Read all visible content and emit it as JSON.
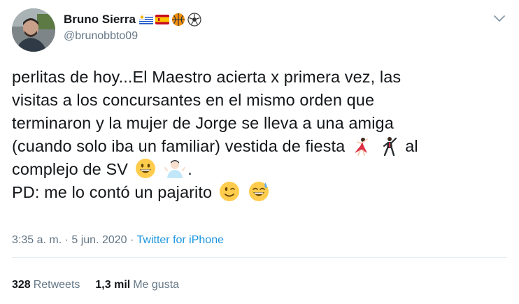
{
  "user": {
    "display_name": "Bruno Sierra",
    "handle": "@brunobbto09",
    "name_emojis": [
      "uruguay-flag-icon",
      "spain-flag-icon",
      "basketball-icon",
      "soccer-ball-icon"
    ]
  },
  "tweet": {
    "lines": [
      "perlitas de hoy...El Maestro acierta x primera vez, las",
      "visitas a los concursantes en el mismo orden que",
      "terminaron y la mujer de Jorge se lleva a una amiga",
      "(cuando solo iba un familiar) vestida de fiesta",
      "al",
      "complejo de SV",
      ".",
      "PD: me lo contó un pajarito"
    ]
  },
  "meta": {
    "time": "3:35 a. m.",
    "sep1": " · ",
    "date": "5 jun. 2020",
    "sep2": " · ",
    "source": "Twitter for iPhone"
  },
  "stats": {
    "retweets_count": "328",
    "retweets_label": "Retweets",
    "likes_count": "1,3 mil",
    "likes_label": "Me gusta"
  },
  "colors": {
    "text": "#14171a",
    "secondary": "#657786",
    "link": "#1b95e0",
    "divider": "#e6ecf0"
  }
}
